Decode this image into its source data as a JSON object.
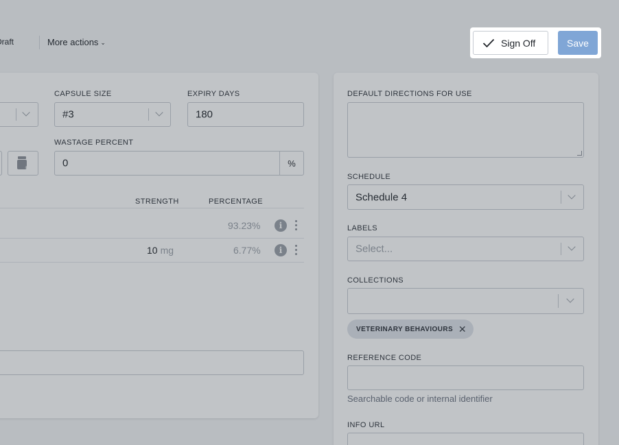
{
  "toolbar": {
    "draft_label": "ate Draft",
    "more_actions_label": "More actions",
    "signoff_label": "Sign Off",
    "save_label": "Save"
  },
  "left_panel": {
    "capsule_size": {
      "label": "CAPSULE SIZE",
      "value": "#3"
    },
    "expiry_days": {
      "label": "EXPIRY DAYS",
      "value": "180"
    },
    "wastage_percent": {
      "label": "WASTAGE PERCENT",
      "value": "0",
      "suffix": "%"
    },
    "table": {
      "headers": {
        "strength": "STRENGTH",
        "percentage": "PERCENTAGE"
      },
      "rows": [
        {
          "strength_value": "",
          "strength_unit": "",
          "percentage": "93.23%"
        },
        {
          "strength_value": "10",
          "strength_unit": "mg",
          "percentage": "6.77%"
        }
      ]
    }
  },
  "right_panel": {
    "directions": {
      "label": "DEFAULT DIRECTIONS FOR USE",
      "value": ""
    },
    "schedule": {
      "label": "SCHEDULE",
      "value": "Schedule 4"
    },
    "labels": {
      "label": "LABELS",
      "placeholder": "Select..."
    },
    "collections": {
      "label": "COLLECTIONS",
      "chip": "VETERINARY BEHAVIOURS"
    },
    "reference_code": {
      "label": "REFERENCE CODE",
      "value": "",
      "help": "Searchable code or internal identifier"
    },
    "info_url": {
      "label": "INFO URL"
    }
  },
  "icons": {
    "check": "check-icon",
    "chevron": "chevron-down-icon",
    "info": "info-icon",
    "kebab": "more-vertical-icon",
    "close": "close-icon",
    "pill_bottle": "pill-bottle-icon"
  },
  "colors": {
    "save_button": "#80a6d6",
    "overlay": "rgba(50,58,70,0.30)"
  }
}
